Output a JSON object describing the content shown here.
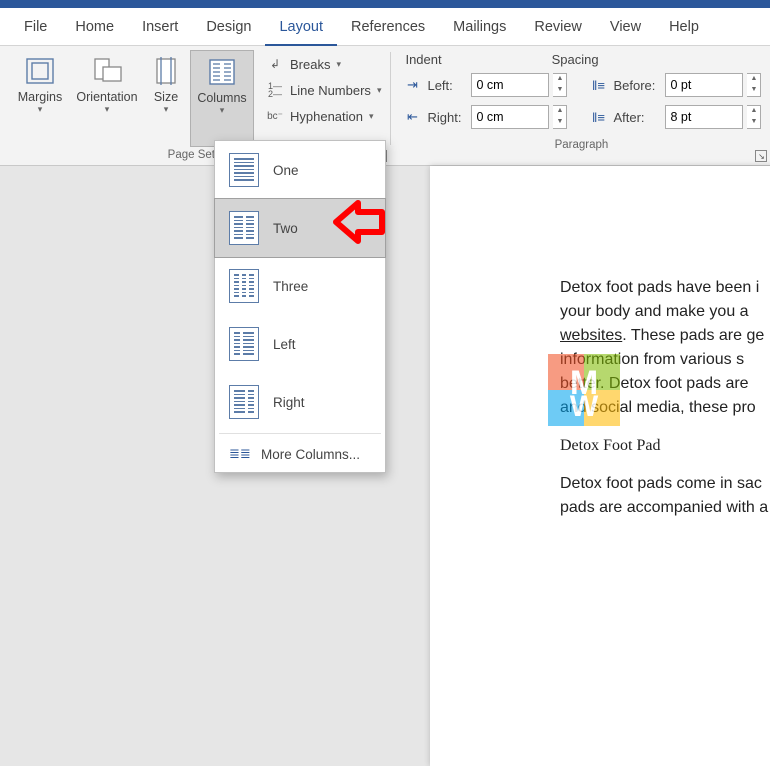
{
  "tabs": {
    "file": "File",
    "home": "Home",
    "insert": "Insert",
    "design": "Design",
    "layout": "Layout",
    "references": "References",
    "mailings": "Mailings",
    "review": "Review",
    "view": "View",
    "help": "Help"
  },
  "page_setup": {
    "margins": "Margins",
    "orientation": "Orientation",
    "size": "Size",
    "columns": "Columns",
    "breaks": "Breaks",
    "line_numbers": "Line Numbers",
    "hyphenation": "Hyphenation",
    "group_label": "Page Setup"
  },
  "paragraph": {
    "indent_head": "Indent",
    "spacing_head": "Spacing",
    "left_label": "Left:",
    "right_label": "Right:",
    "before_label": "Before:",
    "after_label": "After:",
    "left_val": "0 cm",
    "right_val": "0 cm",
    "before_val": "0 pt",
    "after_val": "8 pt",
    "group_label": "Paragraph"
  },
  "columns_menu": {
    "one": "One",
    "two": "Two",
    "three": "Three",
    "left": "Left",
    "right": "Right",
    "more": "More Columns..."
  },
  "doc": {
    "p1a": "Detox foot pads have been i",
    "p1b": "your body and make you a ",
    "p1c": "websites",
    "p1d": ". These pads are ge",
    "p1e": "information from various s",
    "p1f": "better. Detox foot pads are ",
    "p1g": "and social media, these pro",
    "p2": "Detox Foot Pad",
    "p3": "Detox foot pads come in sac",
    "p4": "pads are accompanied with a"
  }
}
